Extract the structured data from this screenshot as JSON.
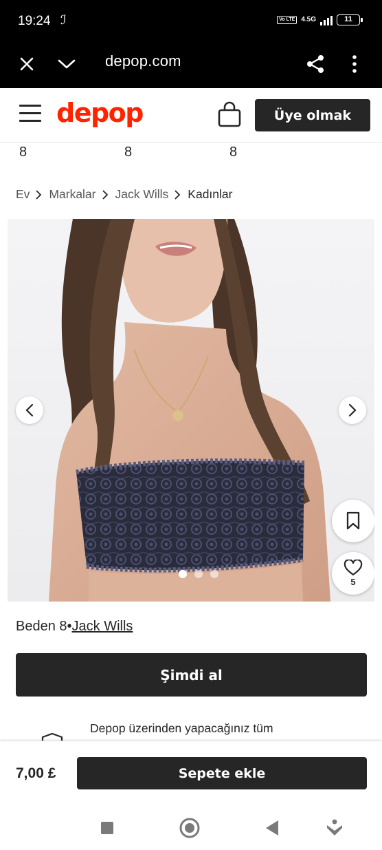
{
  "status_bar": {
    "time": "19:24",
    "notification_glyph": "ℐ",
    "volte": "Vo LTE",
    "network": "4.5G",
    "battery": "11"
  },
  "browser": {
    "url": "depop.com",
    "close_icon": "close-icon",
    "menu_icon": "chevron-down-icon",
    "share_icon": "share-icon",
    "overflow_icon": "more-vert-icon"
  },
  "header": {
    "logo": "depop",
    "join_label": "Üye olmak",
    "brand_color": "#ff2300"
  },
  "carousel_strip": {
    "items": [
      {
        "size": "8"
      },
      {
        "size": "8"
      },
      {
        "size": "8"
      }
    ]
  },
  "breadcrumb": {
    "items": [
      "Ev",
      "Markalar",
      "Jack Wills"
    ],
    "current": "Kadınlar"
  },
  "product": {
    "like_count": "5",
    "image_count": 3,
    "active_image": 1,
    "size_text": "Beden 8•",
    "brand": "Jack Wills",
    "buy_now_label": "Şimdi al",
    "protection_text": "Depop üzerinden yapacağınız tüm",
    "price": "7,00 £",
    "add_to_cart_label": "Sepete ekle"
  }
}
